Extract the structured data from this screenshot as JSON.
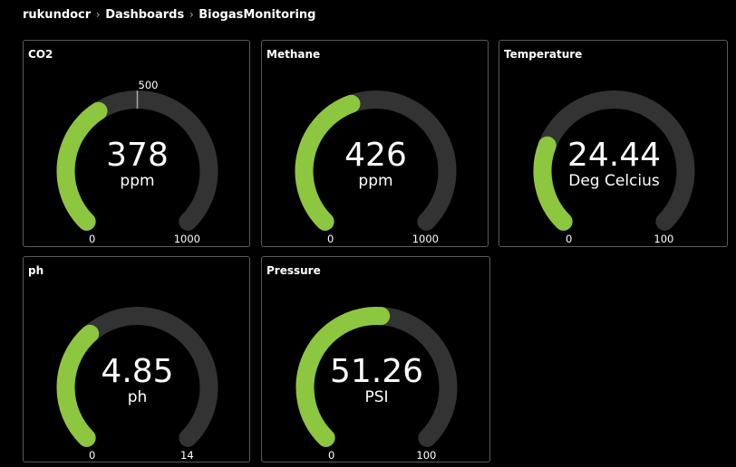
{
  "breadcrumb": {
    "items": [
      "rukundocr",
      "Dashboards",
      "BiogasMonitoring"
    ],
    "separator": "›"
  },
  "colors": {
    "fill": "#8dc63f",
    "track": "#333333",
    "background": "#000000",
    "border": "#5a5a5a",
    "marker": "#aaaaaa"
  },
  "gauges": [
    {
      "title": "CO2",
      "value": "378",
      "unit": "ppm",
      "min": "0",
      "max": "1000",
      "num_value": 378,
      "num_min": 0,
      "num_max": 1000,
      "marker_label": "500",
      "marker_value": 500
    },
    {
      "title": "Methane",
      "value": "426",
      "unit": "ppm",
      "min": "0",
      "max": "1000",
      "num_value": 426,
      "num_min": 0,
      "num_max": 1000
    },
    {
      "title": "Temperature",
      "value": "24.44",
      "unit": "Deg Celcius",
      "min": "0",
      "max": "100",
      "num_value": 24.44,
      "num_min": 0,
      "num_max": 100
    },
    {
      "title": "ph",
      "value": "4.85",
      "unit": "ph",
      "min": "0",
      "max": "14",
      "num_value": 4.85,
      "num_min": 0,
      "num_max": 14
    },
    {
      "title": "Pressure",
      "value": "51.26",
      "unit": "PSI",
      "min": "0",
      "max": "100",
      "num_value": 51.26,
      "num_min": 0,
      "num_max": 100
    }
  ]
}
